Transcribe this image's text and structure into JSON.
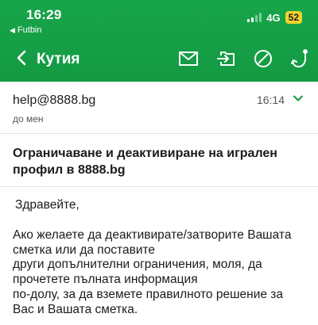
{
  "status_bar": {
    "time": "16:29",
    "back_app": "Futbin",
    "network": "4G",
    "battery": "52"
  },
  "toolbar": {
    "back_icon": "chevron-left-icon",
    "folder_title": "Кутия",
    "icons": [
      "envelope-icon",
      "move-to-folder-icon",
      "block-icon",
      "hook-icon"
    ]
  },
  "message": {
    "sender": "help@8888.bg",
    "recipient": "до мен",
    "time": "16:14",
    "subject_lines": [
      "Ограничаване и деактивиране на игрален",
      "профил в 8888.bg"
    ],
    "greeting": "Здравейте,",
    "body_lines": [
      "Ако желаете да деактивирате/затворите Вашата",
      "сметка или да поставите",
      "други допълнителни ограничения, моля, да",
      "прочетете пълната информация",
      "по-долу, за да вземете правилното решение за",
      "Вас и Вашата сметка."
    ]
  },
  "colors": {
    "header_green": "#18a54a",
    "chevron_green": "#139a42",
    "battery_yellow": "#f2d22e"
  }
}
